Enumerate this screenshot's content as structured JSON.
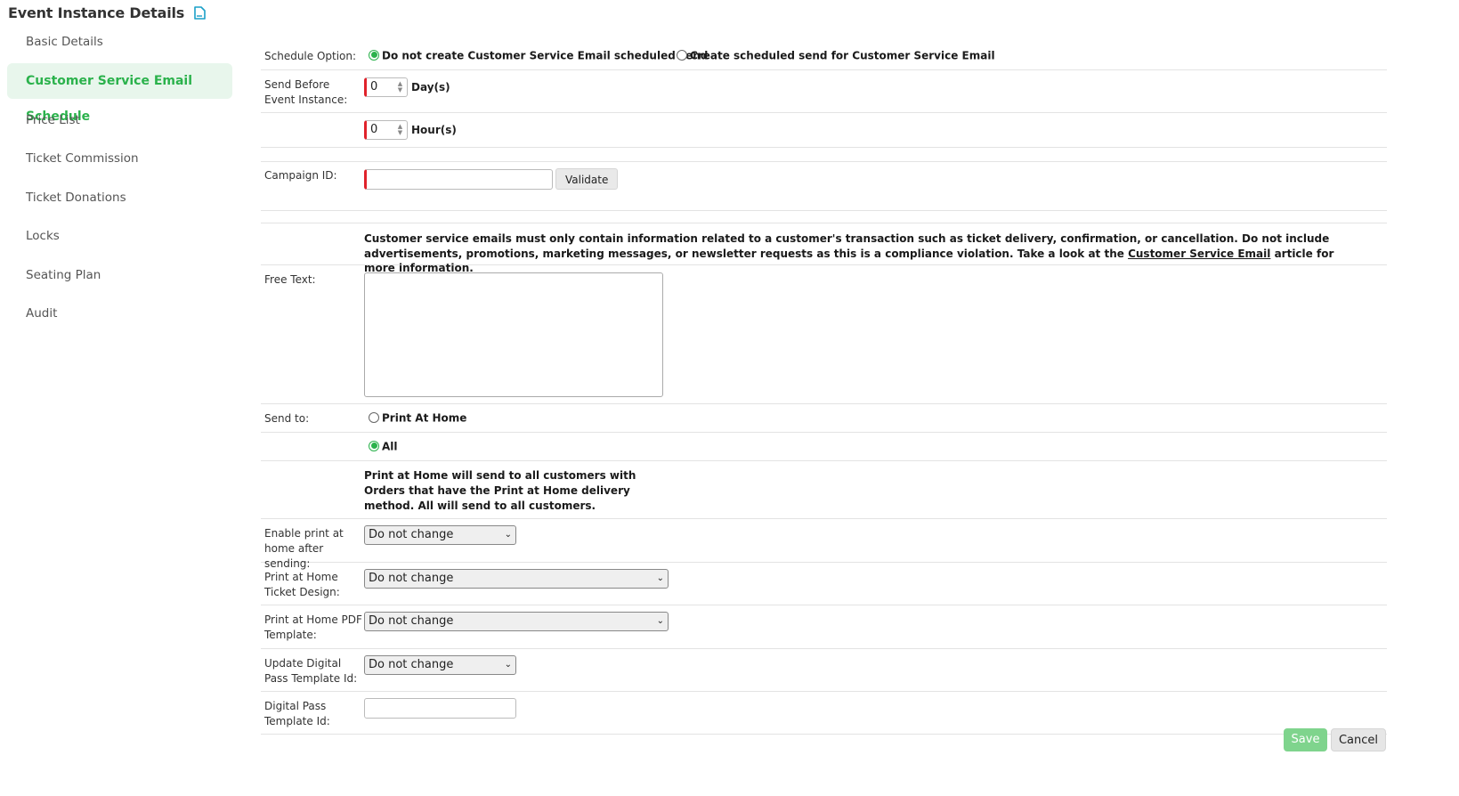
{
  "page": {
    "title": "Event Instance Details",
    "title_icon": "document-icon"
  },
  "sidebar": {
    "items": [
      {
        "label": "Basic Details"
      },
      {
        "label": "Customer Service Email Schedule",
        "active": true
      },
      {
        "label": "Price List"
      },
      {
        "label": "Ticket Commission"
      },
      {
        "label": "Ticket Donations"
      },
      {
        "label": "Locks"
      },
      {
        "label": "Seating Plan"
      },
      {
        "label": "Audit"
      }
    ]
  },
  "form": {
    "schedule_option": {
      "label": "Schedule Option:",
      "options": [
        {
          "label": "Do not create Customer Service Email scheduled send",
          "checked": true
        },
        {
          "label": "Create scheduled send for Customer Service Email",
          "checked": false
        }
      ]
    },
    "send_before": {
      "label": "Send Before Event Instance:",
      "days_value": "0",
      "days_unit": "Day(s)",
      "hours_value": "0",
      "hours_unit": "Hour(s)"
    },
    "campaign": {
      "label": "Campaign ID:",
      "value": "",
      "validate_label": "Validate"
    },
    "notice": {
      "text_before": "Customer service emails must only contain information related to a customer's transaction such as ticket delivery, confirmation, or cancellation. Do not include advertisements, promotions, marketing messages, or newsletter requests as this is a compliance violation. Take a look at the ",
      "link": "Customer Service Email",
      "text_after": " article for more information."
    },
    "free_text": {
      "label": "Free Text:",
      "value": ""
    },
    "send_to": {
      "label": "Send to:",
      "options": [
        {
          "label": "Print At Home",
          "checked": false
        },
        {
          "label": "All",
          "checked": true
        }
      ],
      "help": "Print at Home will send to all customers with Orders that have the Print at Home delivery method. All will send to all customers."
    },
    "enable_pah": {
      "label": "Enable print at home after sending:",
      "value": "Do not change"
    },
    "pah_ticket_design": {
      "label": "Print at Home Ticket Design:",
      "value": "Do not change"
    },
    "pah_pdf_template": {
      "label": "Print at Home PDF Template:",
      "value": "Do not change"
    },
    "update_digital_pass": {
      "label": "Update Digital Pass Template Id:",
      "value": "Do not change"
    },
    "digital_pass_template": {
      "label": "Digital Pass Template Id:",
      "value": ""
    }
  },
  "actions": {
    "save_label": "Save",
    "cancel_label": "Cancel"
  },
  "colors": {
    "accent": "#2bb24c",
    "active_bg": "#e8f6ec",
    "required_marker": "#e0222b",
    "save_bg": "#7fd48d"
  }
}
